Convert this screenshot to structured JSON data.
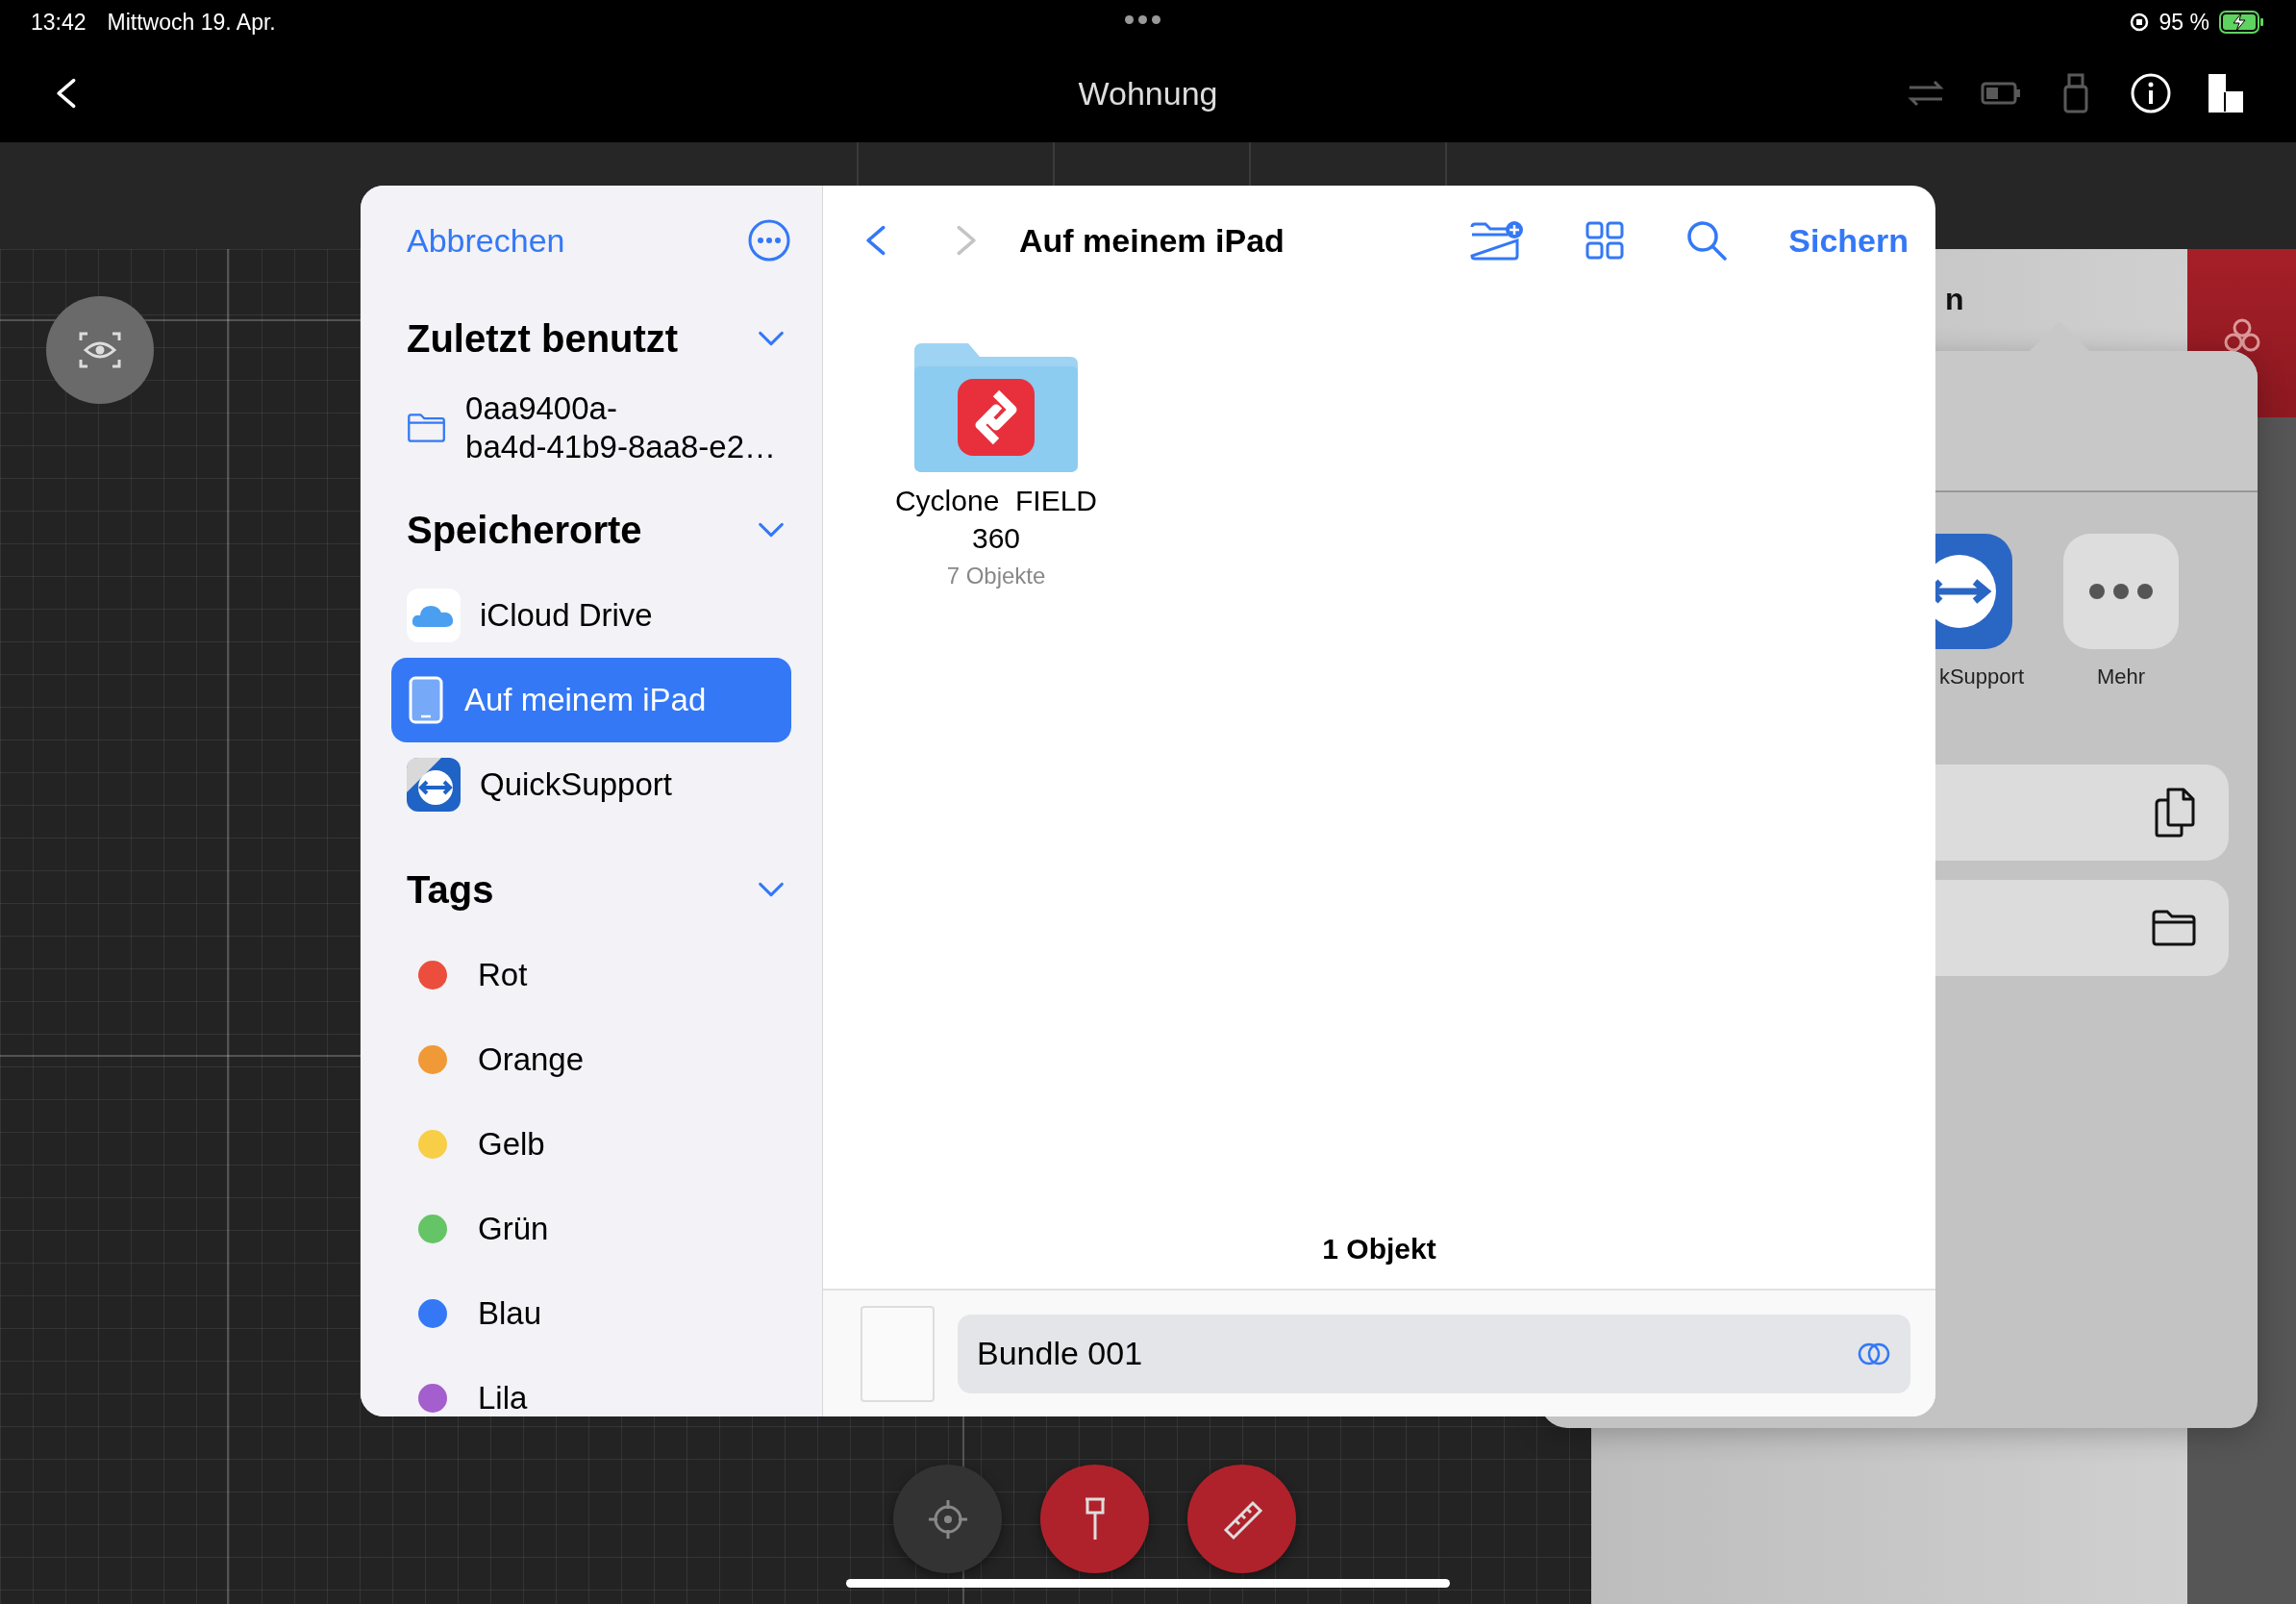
{
  "status_bar": {
    "time": "13:42",
    "date": "Mittwoch 19. Apr.",
    "battery": "95 %",
    "charging": true
  },
  "nav_bar": {
    "title": "Wohnung"
  },
  "background_panel": {
    "title": "n",
    "share_apps": [
      {
        "kind": "app",
        "label": "kSupport"
      },
      {
        "kind": "more",
        "label": "Mehr"
      }
    ],
    "actions": [
      {
        "kind": "copy"
      },
      {
        "kind": "folder"
      }
    ]
  },
  "file_dialog": {
    "cancel": "Abbrechen",
    "sidebar_sections": [
      {
        "title": "Zuletzt benutzt",
        "expanded": true,
        "items": [
          {
            "kind": "folder",
            "label": "0aa9400a-\nba4d-41b9-8aa8-e2…",
            "selected": false
          }
        ]
      },
      {
        "title": "Speicherorte",
        "expanded": true,
        "items": [
          {
            "kind": "icloud",
            "label": "iCloud Drive",
            "selected": false
          },
          {
            "kind": "ipad",
            "label": "Auf meinem iPad",
            "selected": true
          },
          {
            "kind": "quicksupport",
            "label": "QuickSupport",
            "selected": false
          }
        ]
      },
      {
        "title": "Tags",
        "expanded": true,
        "items": [
          {
            "kind": "tag",
            "label": "Rot",
            "color": "#eb4e3d",
            "selected": false
          },
          {
            "kind": "tag",
            "label": "Orange",
            "color": "#f09a37",
            "selected": false
          },
          {
            "kind": "tag",
            "label": "Gelb",
            "color": "#f7ce46",
            "selected": false
          },
          {
            "kind": "tag",
            "label": "Grün",
            "color": "#65c466",
            "selected": false
          },
          {
            "kind": "tag",
            "label": "Blau",
            "color": "#3478f6",
            "selected": false
          },
          {
            "kind": "tag",
            "label": "Lila",
            "color": "#a55ecd",
            "selected": false
          }
        ]
      }
    ],
    "location_title": "Auf meinem iPad",
    "can_go_back": true,
    "can_go_forward": false,
    "save": "Sichern",
    "items": [
      {
        "name": "Cyclone  FIELD\n360",
        "count": "7 Objekte"
      }
    ],
    "item_count": "1 Objekt",
    "filename": "Bundle 001"
  }
}
